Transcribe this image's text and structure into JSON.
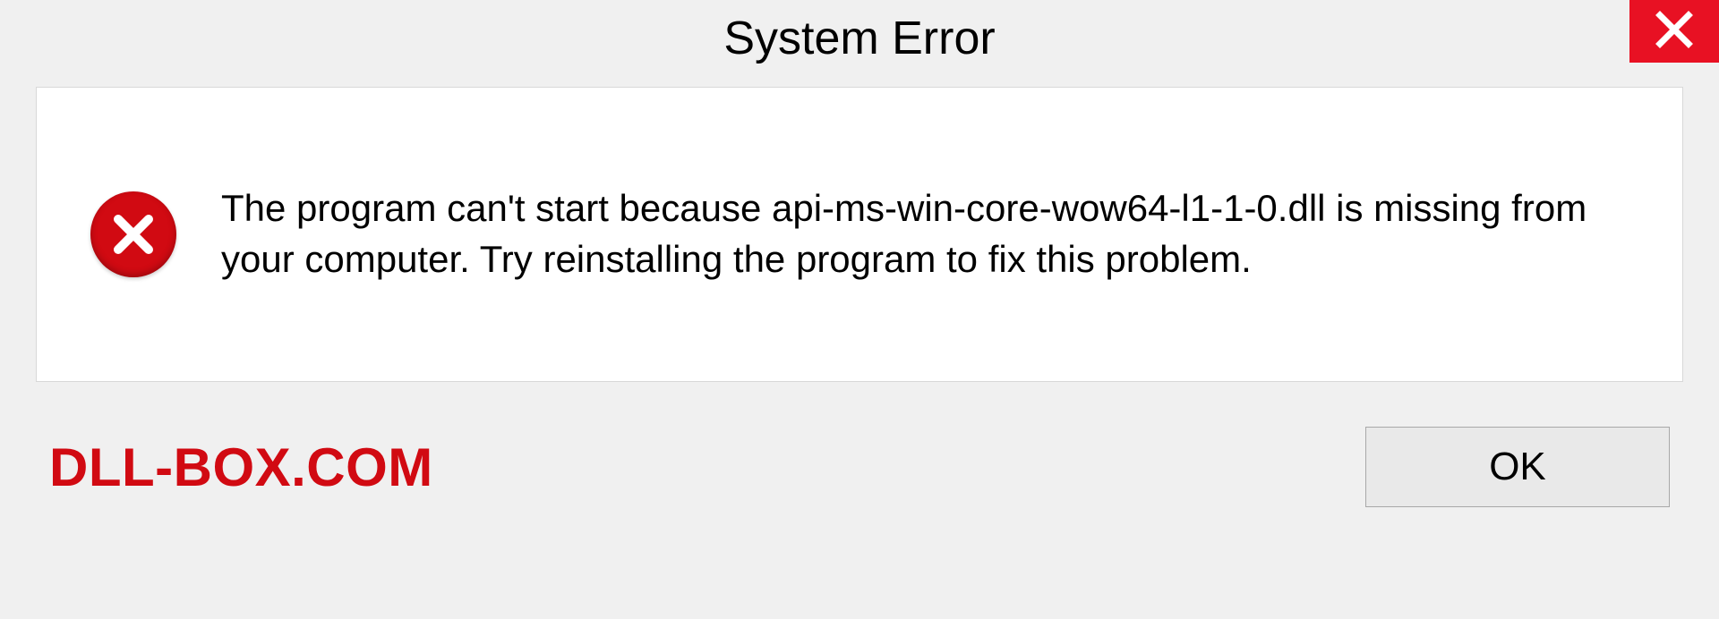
{
  "dialog": {
    "title": "System Error",
    "message": "The program can't start because api-ms-win-core-wow64-l1-1-0.dll is missing from your computer. Try reinstalling the program to fix this problem.",
    "ok_label": "OK"
  },
  "watermark": "DLL-BOX.COM"
}
